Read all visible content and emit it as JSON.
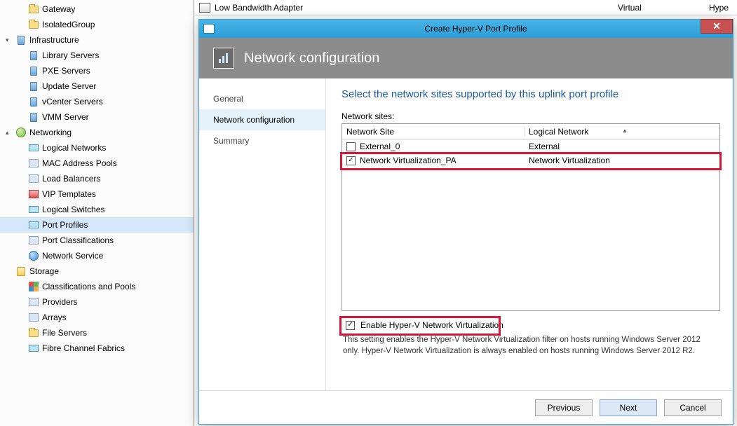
{
  "sidebar": {
    "groups": [
      {
        "label": "Gateway",
        "indent": 1,
        "icon": "folder"
      },
      {
        "label": "IsolatedGroup",
        "indent": 1,
        "icon": "folder"
      },
      {
        "label": "Infrastructure",
        "indent": 0,
        "icon": "server",
        "expander": "▾"
      },
      {
        "label": "Library Servers",
        "indent": 1,
        "icon": "server"
      },
      {
        "label": "PXE Servers",
        "indent": 1,
        "icon": "server"
      },
      {
        "label": "Update Server",
        "indent": 1,
        "icon": "server"
      },
      {
        "label": "vCenter Servers",
        "indent": 1,
        "icon": "server"
      },
      {
        "label": "VMM Server",
        "indent": 1,
        "icon": "server"
      },
      {
        "label": "Networking",
        "indent": 0,
        "icon": "net",
        "expander": "▴"
      },
      {
        "label": "Logical Networks",
        "indent": 1,
        "icon": "switch"
      },
      {
        "label": "MAC Address Pools",
        "indent": 1,
        "icon": "generic"
      },
      {
        "label": "Load Balancers",
        "indent": 1,
        "icon": "generic"
      },
      {
        "label": "VIP Templates",
        "indent": 1,
        "icon": "red"
      },
      {
        "label": "Logical Switches",
        "indent": 1,
        "icon": "switch"
      },
      {
        "label": "Port Profiles",
        "indent": 1,
        "icon": "switch",
        "selected": true
      },
      {
        "label": "Port Classifications",
        "indent": 1,
        "icon": "generic"
      },
      {
        "label": "Network Service",
        "indent": 1,
        "icon": "globe"
      },
      {
        "label": "Storage",
        "indent": 0,
        "icon": "store"
      },
      {
        "label": "Classifications and Pools",
        "indent": 1,
        "icon": "color"
      },
      {
        "label": "Providers",
        "indent": 1,
        "icon": "generic"
      },
      {
        "label": "Arrays",
        "indent": 1,
        "icon": "generic"
      },
      {
        "label": "File Servers",
        "indent": 1,
        "icon": "folder"
      },
      {
        "label": "Fibre Channel Fabrics",
        "indent": 1,
        "icon": "switch"
      }
    ]
  },
  "bgrow": {
    "name": "Low Bandwidth Adapter",
    "type": "Virtual",
    "host": "Hype"
  },
  "wizard": {
    "title": "Create Hyper-V Port Profile",
    "header": "Network configuration",
    "nav": [
      "General",
      "Network configuration",
      "Summary"
    ],
    "nav_active": 1,
    "content_title": "Select the network sites supported by this uplink port profile",
    "sites_label": "Network sites:",
    "columns": [
      "Network Site",
      "Logical Network"
    ],
    "rows": [
      {
        "checked": false,
        "site": "External_0",
        "network": "External"
      },
      {
        "checked": true,
        "site": "Network Virtualization_PA",
        "network": "Network Virtualization"
      }
    ],
    "enable_label": "Enable Hyper-V Network Virtualization",
    "enable_desc": "This setting enables the Hyper-V Network Virtualization filter on hosts running Windows Server 2012 only. Hyper-V Network Virtualization is always enabled on hosts running Windows Server 2012 R2.",
    "buttons": {
      "previous": "Previous",
      "next": "Next",
      "cancel": "Cancel"
    }
  }
}
